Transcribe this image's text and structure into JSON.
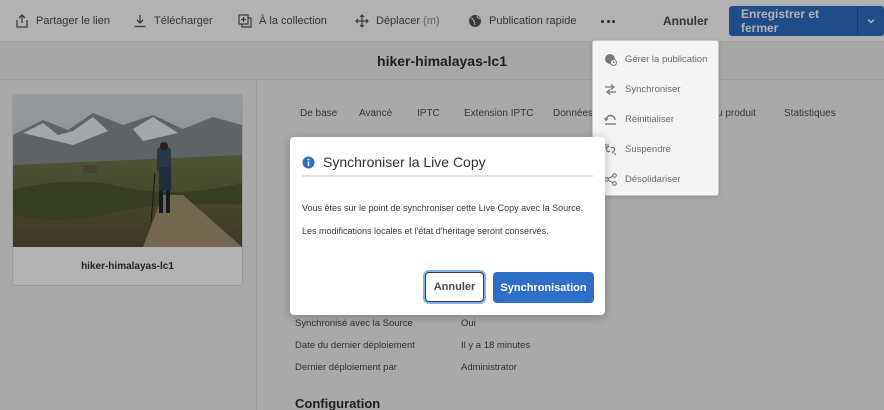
{
  "toolbar": {
    "share_label": "Partager le lien",
    "download_label": "Télécharger",
    "collection_label": "À la collection",
    "move_label": "Déplacer",
    "move_shortcut": "(m)",
    "quick_publish_label": "Publication rapide",
    "cancel_label": "Annuler",
    "save_label": "Enregistrer et fermer"
  },
  "page": {
    "title": "hiker-himalayas-lc1"
  },
  "asset_card": {
    "name": "hiker-himalayas-lc1"
  },
  "tabs": [
    "De base",
    "Avancé",
    "IPTC",
    "Extension IPTC",
    "Données",
    "u produit",
    "Statistiques"
  ],
  "properties": [
    {
      "label": "Synchronisé avec la Source",
      "value": "Oui"
    },
    {
      "label": "Date du dernier déploiement",
      "value": "Il y a 18 minutes"
    },
    {
      "label": "Dernier déploiement par",
      "value": "Administrator"
    }
  ],
  "section": {
    "title": "Configuration"
  },
  "menu": {
    "items": [
      {
        "label": "Gérer la publication",
        "icon": "manage-publication-icon"
      },
      {
        "label": "Synchroniser",
        "icon": "sync-icon"
      },
      {
        "label": "Réinitialiser",
        "icon": "reset-icon"
      },
      {
        "label": "Suspendre",
        "icon": "suspend-icon"
      },
      {
        "label": "Désolidariser",
        "icon": "detach-icon"
      }
    ]
  },
  "dialog": {
    "title": "Synchroniser la Live Copy",
    "line1": "Vous êtes sur le point de synchroniser cette Live Copy avec la Source.",
    "line2": "Les modifications locales et l'état d'héritage seront conservés.",
    "cancel_label": "Annuler",
    "confirm_label": "Synchronisation"
  },
  "colors": {
    "accent": "#2d6fc6",
    "info": "#2d6fc6"
  }
}
